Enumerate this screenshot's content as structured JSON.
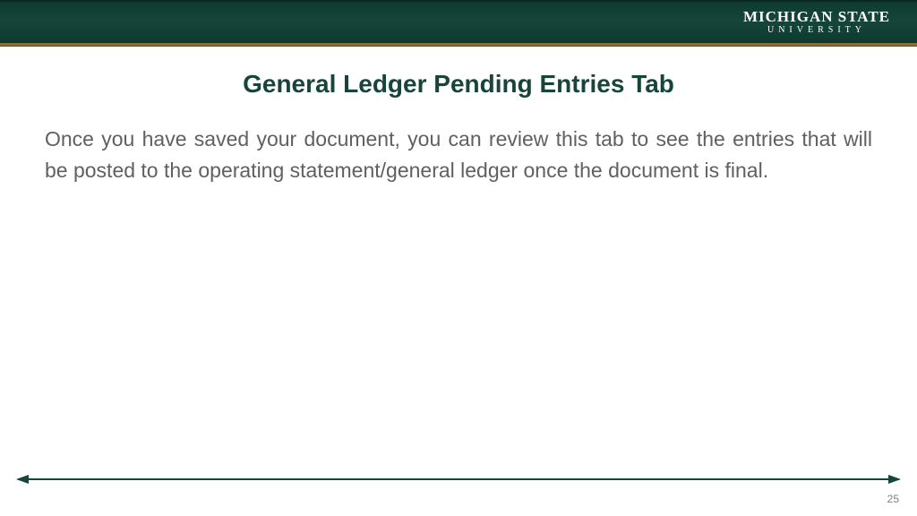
{
  "header": {
    "logo_main": "MICHIGAN STATE",
    "logo_sub": "UNIVERSITY"
  },
  "slide": {
    "title": "General Ledger Pending Entries Tab",
    "body": "Once you have saved your document, you can review this tab to see the entries that will be posted to the operating statement/general ledger once the document is final."
  },
  "footer": {
    "page_number": "25"
  }
}
